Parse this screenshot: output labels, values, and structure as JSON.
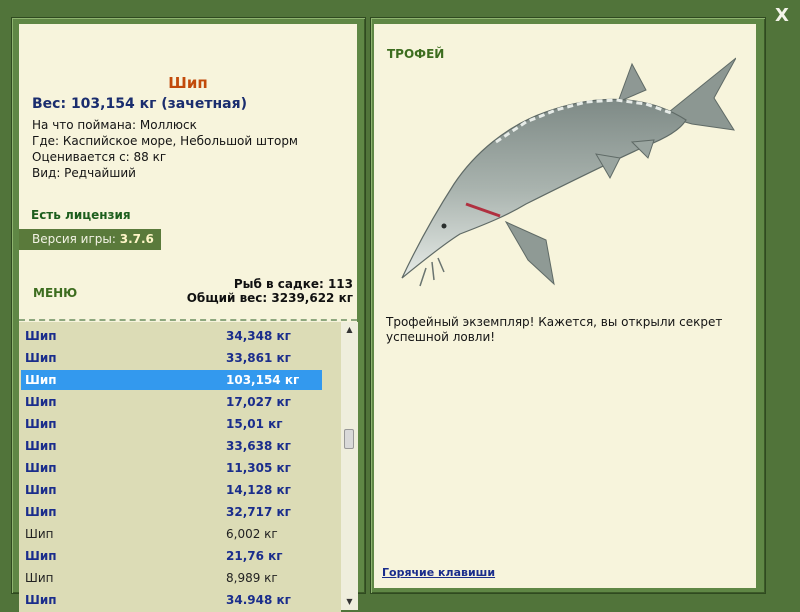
{
  "window": {
    "close_label": "X"
  },
  "fish": {
    "title": "Шип",
    "weight_line": "Вес: 103,154 кг (зачетная)",
    "caught_on": "На что поймана: Моллюск",
    "location": "Где: Каспийское море, Небольшой шторм",
    "rated_from": "Оценивается с: 88 кг",
    "kind": "Вид: Редчайший"
  },
  "license": "Есть лицензия",
  "version": {
    "label": "Версия игры:",
    "value": "3.7.6"
  },
  "menu_label": "МЕНЮ",
  "stats": {
    "fish_count": "Рыб в садке: 113",
    "total_weight": "Общий вес: 3239,622 кг"
  },
  "catch_list": [
    {
      "name": "Шип",
      "weight": "34,348 кг",
      "trophy": true,
      "selected": false
    },
    {
      "name": "Шип",
      "weight": "33,861 кг",
      "trophy": true,
      "selected": false
    },
    {
      "name": "Шип",
      "weight": "103,154 кг",
      "trophy": true,
      "selected": true
    },
    {
      "name": "Шип",
      "weight": "17,027 кг",
      "trophy": true,
      "selected": false
    },
    {
      "name": "Шип",
      "weight": "15,01 кг",
      "trophy": true,
      "selected": false
    },
    {
      "name": "Шип",
      "weight": "33,638 кг",
      "trophy": true,
      "selected": false
    },
    {
      "name": "Шип",
      "weight": "11,305 кг",
      "trophy": true,
      "selected": false
    },
    {
      "name": "Шип",
      "weight": "14,128 кг",
      "trophy": true,
      "selected": false
    },
    {
      "name": "Шип",
      "weight": "32,717 кг",
      "trophy": true,
      "selected": false
    },
    {
      "name": "Шип",
      "weight": "6,002 кг",
      "trophy": false,
      "selected": false
    },
    {
      "name": "Шип",
      "weight": "21,76 кг",
      "trophy": true,
      "selected": false
    },
    {
      "name": "Шип",
      "weight": "8,989 кг",
      "trophy": false,
      "selected": false
    },
    {
      "name": "Шип",
      "weight": "34.948 кг",
      "trophy": true,
      "selected": false
    }
  ],
  "trophy": {
    "tag": "ТРОФЕЙ",
    "text": "Трофейный экземпляр! Кажется, вы открыли секрет успешной ловли!",
    "image_icon": "sturgeon-fish-image"
  },
  "hotkeys_label": "Горячие клавиши",
  "colors": {
    "background": "#51743a",
    "panel": "#f7f4dc",
    "list_bg": "#dcdcb6",
    "selected": "#3399ee",
    "title": "#c24a0a",
    "trophy_text": "#1a2d8c",
    "accent_green": "#3d6d1f"
  }
}
